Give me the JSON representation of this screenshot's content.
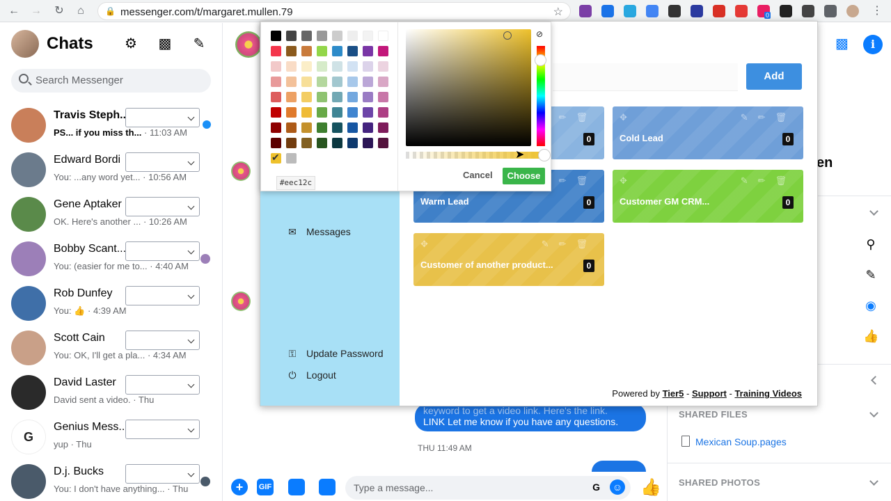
{
  "browser": {
    "url": "messenger.com/t/margaret.mullen.79",
    "extension_badge": "0"
  },
  "sidebar": {
    "title": "Chats",
    "search_placeholder": "Search Messenger",
    "chats": [
      {
        "name": "Travis Steph...",
        "preview": "PS... if you miss th...",
        "time": "· 11:03 AM",
        "unread": true
      },
      {
        "name": "Edward Bordi",
        "preview": "You: ...any word yet...",
        "time": "· 10:56 AM"
      },
      {
        "name": "Gene Aptaker",
        "preview": "OK. Here's another ...",
        "time": "· 10:26 AM"
      },
      {
        "name": "Bobby Scant...",
        "preview": "You: (easier for me to...",
        "time": "· 4:40 AM"
      },
      {
        "name": "Rob Dunfey",
        "preview": "You:",
        "time": "· 4:39 AM"
      },
      {
        "name": "Scott Cain",
        "preview": "You: OK, I'll get a pla...",
        "time": "· 4:34 AM"
      },
      {
        "name": "David Laster",
        "preview": "David sent a video.",
        "time": "· Thu"
      },
      {
        "name": "Genius Mess...",
        "preview": "yup",
        "time": "· Thu"
      },
      {
        "name": "D.j. Bucks",
        "preview": "You: I don't have anything...",
        "time": "· Thu"
      }
    ]
  },
  "conversation": {
    "bubble_line1": "keyword to get a video link. Here's the link.",
    "bubble_line2": "LINK Let me know if you have any questions.",
    "timestamp": "THU 11:49 AM",
    "composer_placeholder": "Type a message...",
    "gif_label": "GIF"
  },
  "info_panel": {
    "partial_name": "en",
    "shared_files_label": "SHARED FILES",
    "file_name": "Mexican Soup.pages",
    "shared_photos_label": "SHARED PHOTOS"
  },
  "crm": {
    "menu": [
      {
        "label": "Messages",
        "icon": "envelope-icon"
      },
      {
        "label": "Update Password",
        "icon": "key-icon"
      },
      {
        "label": "Logout",
        "icon": "power-icon"
      }
    ],
    "add_label": "Add",
    "cards": [
      {
        "title": "",
        "count": "0",
        "color": "#8ab4e0"
      },
      {
        "title": "Cold Lead",
        "count": "0",
        "color": "#6f9fd8"
      },
      {
        "title": "Warm Lead",
        "count": "0",
        "color": "#3f80c8"
      },
      {
        "title": "Customer GM CRM...",
        "count": "0",
        "color": "#7ed13f"
      },
      {
        "title": "Customer of another product...",
        "count": "0",
        "color": "#e8c14a"
      }
    ],
    "footer": {
      "powered_by": "Powered by",
      "tier5": "Tier5",
      "support": "Support",
      "training": "Training Videos",
      "sep": "-"
    }
  },
  "color_picker": {
    "hex": "#eec12c",
    "cancel_label": "Cancel",
    "choose_label": "Choose",
    "selected_color": "#eec12c",
    "palette_rows": [
      [
        "#000000",
        "#444444",
        "#666666",
        "#999999",
        "#cccccc",
        "#eeeeee",
        "#f3f3f3",
        "#ffffff"
      ],
      [
        "#f4364c",
        "#8b5a1d",
        "#c97b3c",
        "#93d64a",
        "#2d8bc9",
        "#1a4f86",
        "#7a36a6",
        "#c2177a"
      ],
      [
        "#f2c9c9",
        "#f9dcc6",
        "#fbeec8",
        "#d6ebc9",
        "#cfe2e6",
        "#d2e2f3",
        "#dcd3ea",
        "#ecd3e0"
      ],
      [
        "#e89a9a",
        "#f3c19a",
        "#f7df99",
        "#b4d79e",
        "#a2c7cf",
        "#a7c8ea",
        "#bba7d7",
        "#d9a7c5"
      ],
      [
        "#dd5d5d",
        "#eda164",
        "#f3cd63",
        "#8fc371",
        "#72a8b4",
        "#73a8df",
        "#9a7cc4",
        "#c877a8"
      ],
      [
        "#c00000",
        "#e07a2c",
        "#efbb37",
        "#68a947",
        "#3f8595",
        "#3f84cf",
        "#6d45a8",
        "#ad3f84"
      ],
      [
        "#8e0000",
        "#ad5a17",
        "#c4912c",
        "#3e7f2f",
        "#15525f",
        "#1656a2",
        "#44237f",
        "#7e1c5b"
      ],
      [
        "#5c0000",
        "#723c0f",
        "#826021",
        "#285520",
        "#0c3840",
        "#0e396e",
        "#2c1656",
        "#54133d"
      ],
      [
        "#eec12c",
        "#bbbbbb"
      ]
    ]
  }
}
